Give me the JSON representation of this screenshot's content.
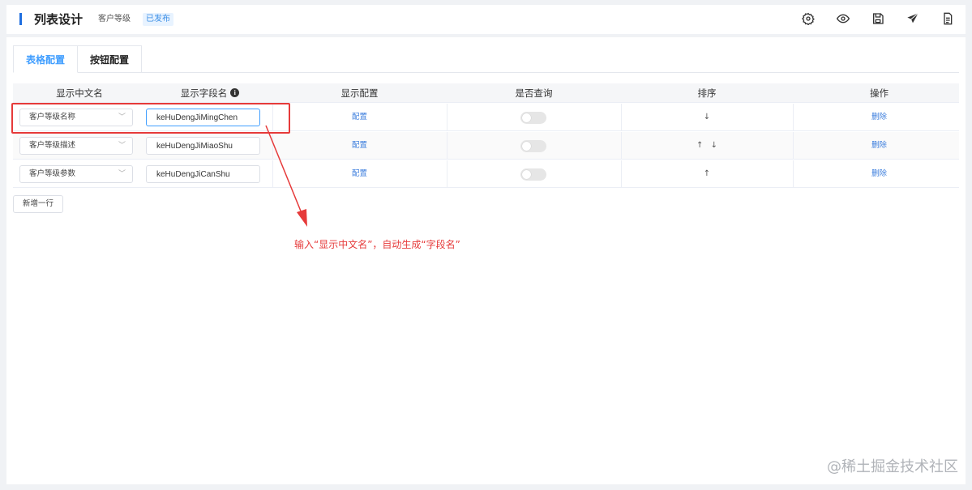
{
  "header": {
    "title": "列表设计",
    "subtitle": "客户等级",
    "badge": "已发布",
    "tools": [
      "gear-icon",
      "eye-icon",
      "save-icon",
      "send-icon",
      "document-icon"
    ]
  },
  "tabs": [
    {
      "label": "表格配置",
      "active": true
    },
    {
      "label": "按钮配置",
      "active": false
    }
  ],
  "table": {
    "columns": [
      "显示中文名",
      "显示字段名",
      "显示配置",
      "是否查询",
      "排序",
      "操作"
    ],
    "rows": [
      {
        "cn_name": "客户等级名称",
        "field_name": "keHuDengJiMingChen",
        "config": "配置",
        "query": false,
        "sort_up": "",
        "sort_down": "↓",
        "action": "删除"
      },
      {
        "cn_name": "客户等级描述",
        "field_name": "keHuDengJiMiaoShu",
        "config": "配置",
        "query": false,
        "sort_up": "↑",
        "sort_down": "↓",
        "action": "删除"
      },
      {
        "cn_name": "客户等级参数",
        "field_name": "keHuDengJiCanShu",
        "config": "配置",
        "query": false,
        "sort_up": "↑",
        "sort_down": "",
        "action": "删除"
      }
    ],
    "add_row_label": "新增一行"
  },
  "annotation": {
    "text": "输入“显示中文名”，自动生成“字段名”",
    "color": "#e63a3a"
  },
  "watermark": "@稀土掘金技术社区",
  "colors": {
    "accent": "#409eff",
    "link": "#3b7ddd",
    "header_bar": "#1f6fe0"
  }
}
